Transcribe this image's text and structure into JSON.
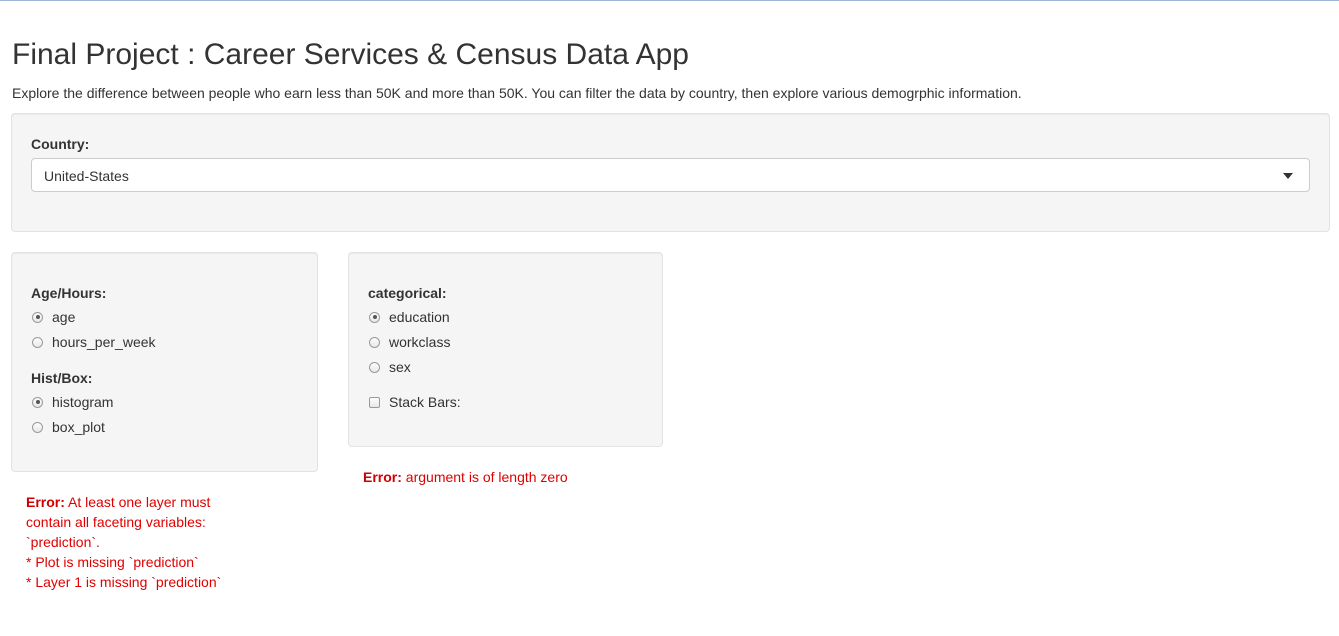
{
  "header": {
    "title": "Final Project : Career Services & Census Data App",
    "subtitle": "Explore the difference between people who earn less than 50K and more than 50K. You can filter the data by country, then explore various demogrphic information."
  },
  "country_panel": {
    "label": "Country:",
    "selected": "United-States"
  },
  "age_panel": {
    "age_hours_label": "Age/Hours:",
    "age_hours_options": [
      {
        "label": "age",
        "checked": true
      },
      {
        "label": "hours_per_week",
        "checked": false
      }
    ],
    "hist_box_label": "Hist/Box:",
    "hist_box_options": [
      {
        "label": "histogram",
        "checked": true
      },
      {
        "label": "box_plot",
        "checked": false
      }
    ]
  },
  "categorical_panel": {
    "label": "categorical:",
    "options": [
      {
        "label": "education",
        "checked": true
      },
      {
        "label": "workclass",
        "checked": false
      },
      {
        "label": "sex",
        "checked": false
      }
    ],
    "stack_bars_label": "Stack Bars:",
    "stack_bars_checked": false
  },
  "errors": {
    "left": {
      "prefix": "Error:",
      "lines": [
        "At least one layer must",
        "contain all faceting variables:",
        "`prediction`.",
        "* Plot is missing `prediction`",
        "* Layer 1 is missing `prediction`"
      ]
    },
    "right": {
      "prefix": "Error:",
      "message": "argument is of length zero"
    }
  },
  "colors": {
    "error": "#e00000",
    "well_bg": "#f5f5f5",
    "text": "#333333"
  }
}
